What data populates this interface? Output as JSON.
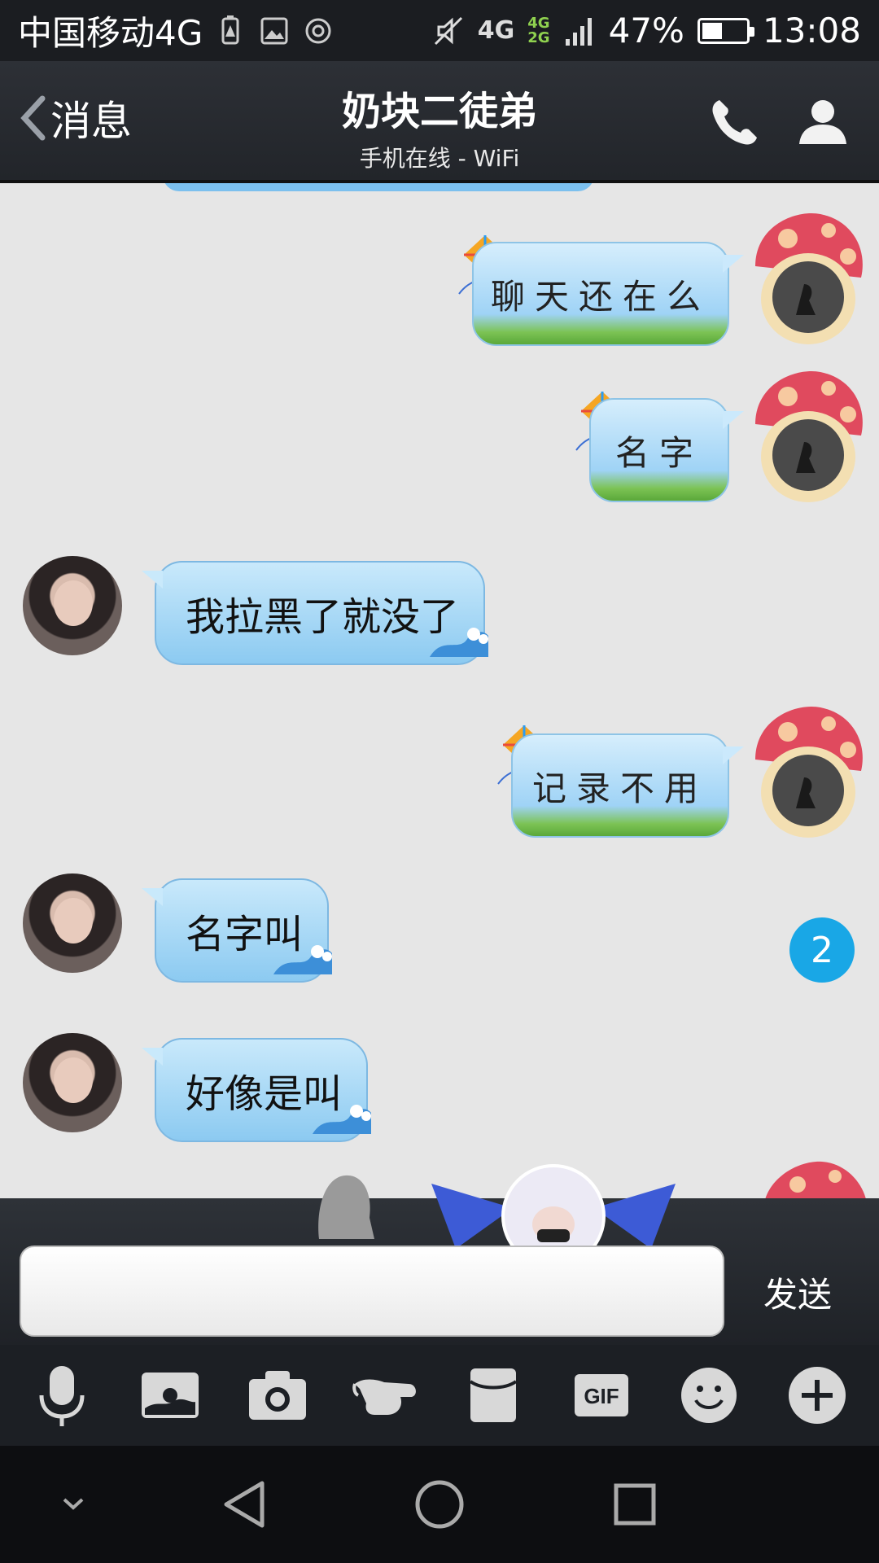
{
  "status_bar": {
    "carrier": "中国移动4G",
    "net_primary": "4G",
    "net_secondary_top": "4G",
    "net_secondary_bottom": "2G",
    "battery": "47%",
    "battery_level": 0.47,
    "time": "13:08"
  },
  "header": {
    "back_label": "消息",
    "title": "奶块二徒弟",
    "subtitle": "手机在线 - WiFi"
  },
  "messages": [
    {
      "side": "right",
      "text": "聊天还在么"
    },
    {
      "side": "right",
      "text": "名字"
    },
    {
      "side": "left",
      "text": "我拉黑了就没了"
    },
    {
      "side": "right",
      "text": "记录不用"
    },
    {
      "side": "left",
      "text": "名字叫"
    },
    {
      "side": "left",
      "text": "好像是叫"
    }
  ],
  "unread_badge": "2",
  "input": {
    "value": "",
    "placeholder": "",
    "send_label": "发送"
  },
  "toolbar": {
    "items": [
      "mic-icon",
      "image-icon",
      "camera-icon",
      "poke-icon",
      "red-packet-icon",
      "gif-icon",
      "emoji-icon",
      "plus-icon"
    ],
    "gif_label": "GIF"
  },
  "colors": {
    "header_bg": "#2d3036",
    "chat_bg": "#e6e6e6",
    "bubble_left": "#9fd3f6",
    "badge": "#19a7e6"
  }
}
